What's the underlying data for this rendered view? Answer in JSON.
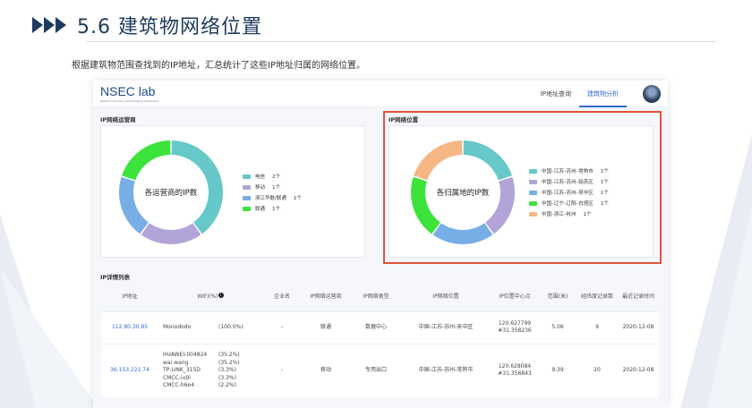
{
  "slide": {
    "title": "5.6 建筑物网络位置",
    "description": "根据建筑物范围查找到的IP地址，汇总统计了这些IP地址归属的网络位置。"
  },
  "app": {
    "logo": "NSEC lab",
    "logo_sub": "Network Security and Emerging Computing",
    "nav": [
      "IP地址查询",
      "建筑物分析"
    ],
    "active_nav": 1
  },
  "isp_panel": {
    "label": "IP网络运营商",
    "center_text": "各运营商的IP数",
    "legend": [
      {
        "name": "电信",
        "count": "2个",
        "color": "#66c8c8",
        "value": 2
      },
      {
        "name": "移动",
        "count": "1个",
        "color": "#b2a4d8",
        "value": 1
      },
      {
        "name": "浙江华数/联通",
        "count": "1个",
        "color": "#78aee6",
        "value": 1
      },
      {
        "name": "联通",
        "count": "1个",
        "color": "#3be33b",
        "value": 1
      }
    ]
  },
  "loc_panel": {
    "label": "IP网络位置",
    "center_text": "各归属地的IP数",
    "legend": [
      {
        "name": "中国–江苏–苏州–常熟市",
        "count": "1个",
        "color": "#66c8c8",
        "value": 1
      },
      {
        "name": "中国–江苏–苏州–姑苏区",
        "count": "1个",
        "color": "#b2a4d8",
        "value": 1
      },
      {
        "name": "中国–江苏–苏州–吴中区",
        "count": "1个",
        "color": "#78aee6",
        "value": 1
      },
      {
        "name": "中国–辽宁–辽阳–白塔区",
        "count": "1个",
        "color": "#3be33b",
        "value": 1
      },
      {
        "name": "中国–浙江–杭州",
        "count": "1个",
        "color": "#f6b784",
        "value": 1
      }
    ]
  },
  "table": {
    "label": "IP详情列表",
    "headers": [
      "IP地址",
      "WIFI(%)",
      "企业名",
      "IP网络运营商",
      "IP网络类型",
      "IP网络位置",
      "IP位置中心点",
      "范围(米)",
      "经纬度记录数",
      "最近记录时间"
    ],
    "rows": [
      {
        "ip": "112.80.30.85",
        "wifi_names": [
          "Monododo"
        ],
        "wifi_pcts": [
          "(100.0%)"
        ],
        "company": "-",
        "isp": "联通",
        "type": "数据中心",
        "location": "中国-江苏-苏州-吴中区",
        "center": [
          "120.627799",
          "#31.358236"
        ],
        "range": "5.06",
        "records": "9",
        "date": "2020-12-08"
      },
      {
        "ip": "36.153.221.74",
        "wifi_names": [
          "HUAWEI-004824",
          "wai wang",
          "TP-LINK_315D",
          "CMCC-iu9i",
          "CMCC-h6e4"
        ],
        "wifi_pcts": [
          "(35.2%)",
          "(35.2%)",
          "(3.3%)",
          "(3.3%)",
          "(2.2%)"
        ],
        "company": "-",
        "isp": "移动",
        "type": "专用出口",
        "location": "中国-江苏-苏州-常熟市",
        "center": [
          "120.628084",
          "#31.356843"
        ],
        "range": "9.39",
        "records": "20",
        "date": "2020-12-08"
      }
    ]
  }
}
